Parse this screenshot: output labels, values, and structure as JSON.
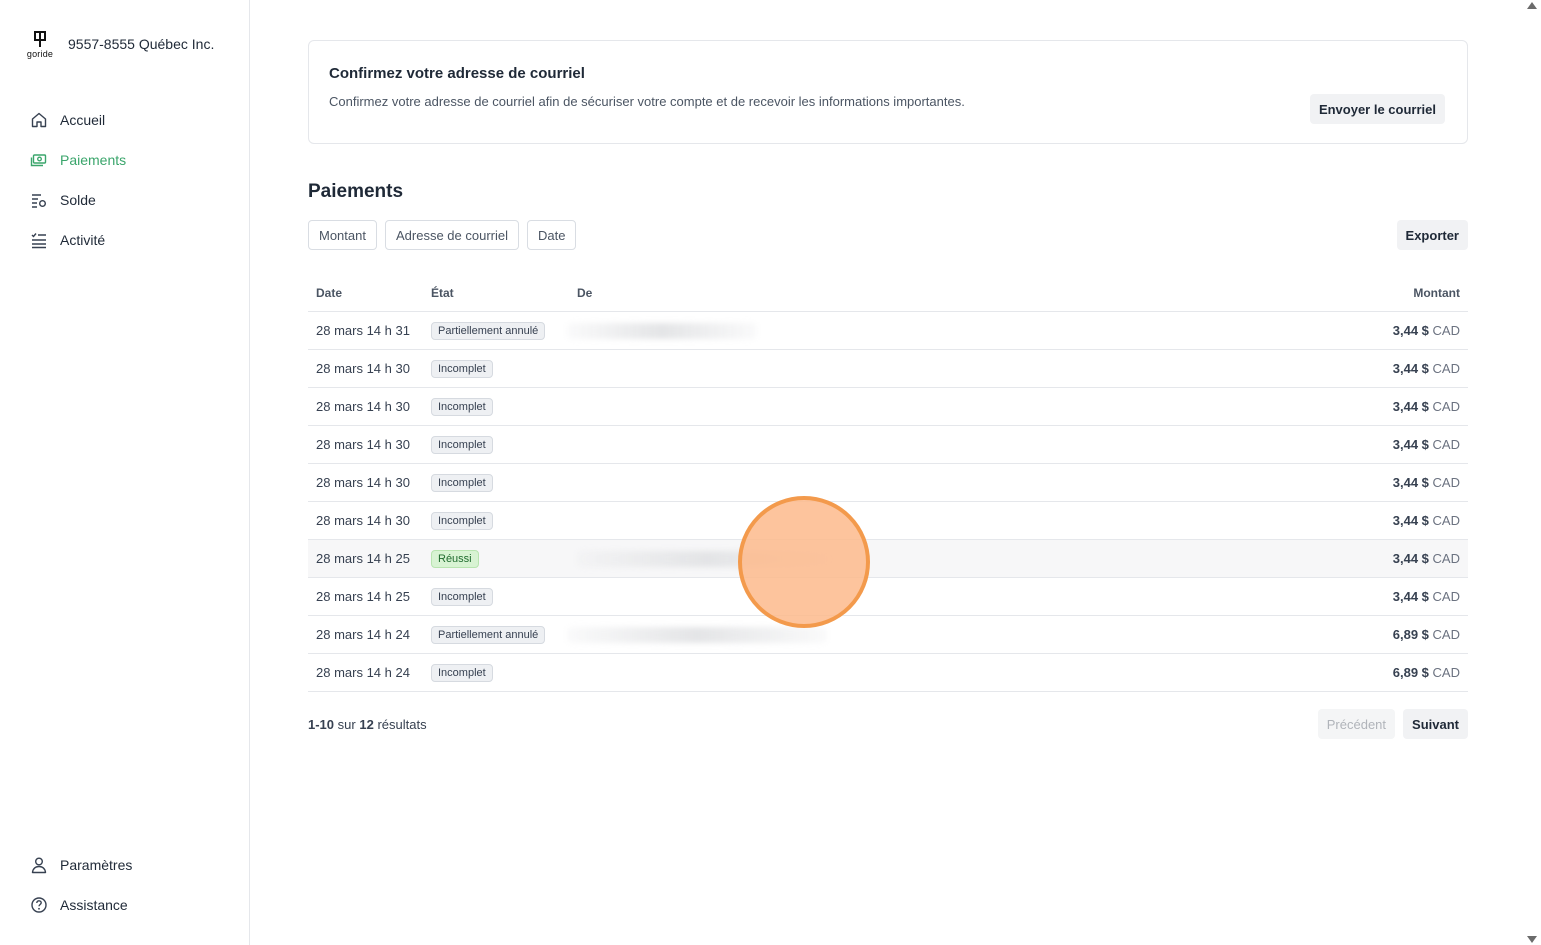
{
  "brand": {
    "logo_text": "goride",
    "name": "9557-8555 Québec Inc."
  },
  "nav": {
    "items": [
      {
        "label": "Accueil",
        "icon": "home-icon",
        "active": false
      },
      {
        "label": "Paiements",
        "icon": "payments-icon",
        "active": true
      },
      {
        "label": "Solde",
        "icon": "balance-icon",
        "active": false
      },
      {
        "label": "Activité",
        "icon": "activity-icon",
        "active": false
      }
    ],
    "bottom": [
      {
        "label": "Paramètres",
        "icon": "user-icon"
      },
      {
        "label": "Assistance",
        "icon": "help-icon"
      }
    ]
  },
  "notice": {
    "title": "Confirmez votre adresse de courriel",
    "description": "Confirmez votre adresse de courriel afin de sécuriser votre compte et de recevoir les informations importantes.",
    "button": "Envoyer le courriel"
  },
  "payments": {
    "title": "Paiements",
    "filters": [
      "Montant",
      "Adresse de courriel",
      "Date"
    ],
    "export": "Exporter",
    "columns": {
      "date": "Date",
      "state": "État",
      "from": "De",
      "amount": "Montant"
    },
    "rows": [
      {
        "date": "28 mars 14 h 31",
        "state": "Partiellement annulé",
        "amount": "3,44 $",
        "currency": "CAD"
      },
      {
        "date": "28 mars 14 h 30",
        "state": "Incomplet",
        "amount": "3,44 $",
        "currency": "CAD"
      },
      {
        "date": "28 mars 14 h 30",
        "state": "Incomplet",
        "amount": "3,44 $",
        "currency": "CAD"
      },
      {
        "date": "28 mars 14 h 30",
        "state": "Incomplet",
        "amount": "3,44 $",
        "currency": "CAD"
      },
      {
        "date": "28 mars 14 h 30",
        "state": "Incomplet",
        "amount": "3,44 $",
        "currency": "CAD"
      },
      {
        "date": "28 mars 14 h 30",
        "state": "Incomplet",
        "amount": "3,44 $",
        "currency": "CAD"
      },
      {
        "date": "28 mars 14 h 25",
        "state": "Réussi",
        "amount": "3,44 $",
        "currency": "CAD"
      },
      {
        "date": "28 mars 14 h 25",
        "state": "Incomplet",
        "amount": "3,44 $",
        "currency": "CAD"
      },
      {
        "date": "28 mars 14 h 24",
        "state": "Partiellement annulé",
        "amount": "6,89 $",
        "currency": "CAD"
      },
      {
        "date": "28 mars 14 h 24",
        "state": "Incomplet",
        "amount": "6,89 $",
        "currency": "CAD"
      }
    ],
    "pagination": {
      "range": "1-10",
      "sur": "sur",
      "total": "12",
      "suffix": "résultats",
      "prev": "Précédent",
      "next": "Suivant"
    }
  },
  "colors": {
    "accent": "#3aa56b",
    "success_bg": "#d8f3d3",
    "cursor_highlight": "#f39a4c"
  }
}
